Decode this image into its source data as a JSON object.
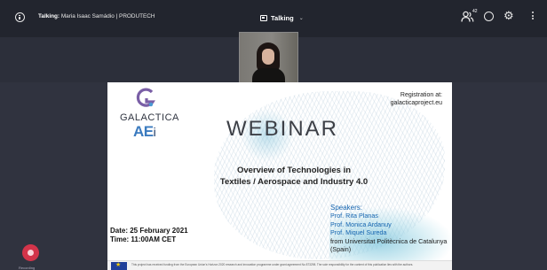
{
  "topbar": {
    "talking_label": "Talking:",
    "talking_names": "Maria Isaac Samádio | PRODUTECH",
    "view_label": "Talking",
    "participants_count": "42"
  },
  "slide": {
    "logo_name": "GALACTICA",
    "logo_sub": "AE",
    "logo_sub_i": "i",
    "title": "WEBINAR",
    "registration_line1": "Registration at:",
    "registration_line2": "galacticaproject.eu",
    "overview_line1": "Overview of Technologies in",
    "overview_line2": "Textiles / Aerospace and Industry 4.0",
    "date": "Date: 25 February 2021",
    "time": "Time: 11:00AM CET",
    "speakers_heading": "Speakers:",
    "speakers": [
      "Prof. Rita Planas",
      "Prof. Monica Ardanuy",
      "Prof. Miquel Sureda"
    ],
    "affiliation_line1": "from Universitat Politècnica de Catalunya",
    "affiliation_line2": "(Spain)",
    "footer_text": "This project has received funding from the European Union's Horizon 2020 research and innovation programme under grant agreement No 873298. The sole responsibility for the content of this publication lies with the authors."
  },
  "controls": {
    "record_label": "Recording"
  },
  "colors": {
    "topbar_bg": "#22252e",
    "stage_bg": "#30333f",
    "record_red": "#d3344a",
    "speaker_blue": "#1565b0",
    "aei_blue": "#3b7bbf"
  },
  "icons": [
    "info-icon",
    "view-icon",
    "chevron-down-icon",
    "people-icon",
    "chat-icon",
    "gear-icon",
    "more-vertical-icon",
    "record-icon",
    "eu-flag-icon"
  ]
}
